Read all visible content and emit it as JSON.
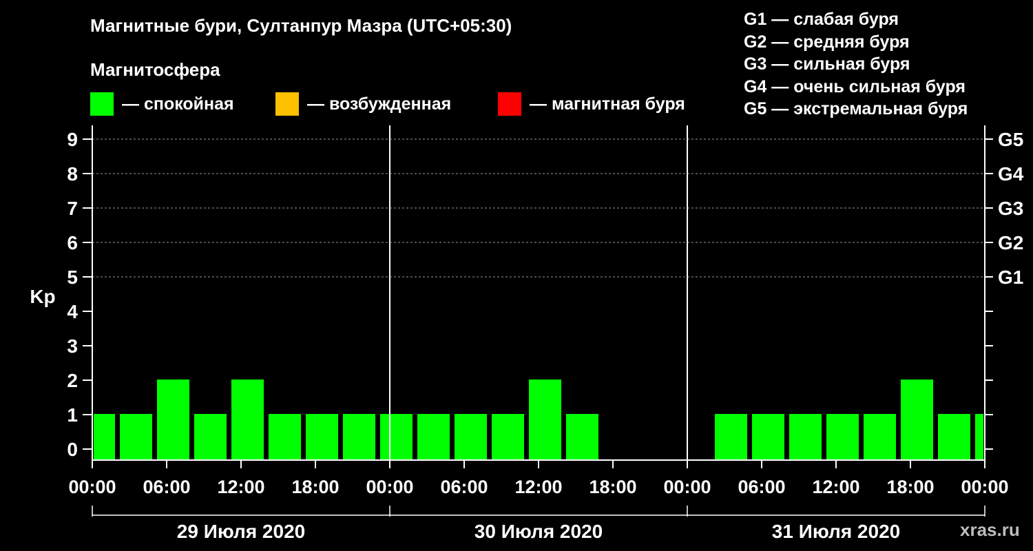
{
  "title": "Магнитные бури, Султанпур Мазра (UTC+05:30)",
  "magnetosphere_label": "Магнитосфера",
  "legend": [
    {
      "label": "— спокойная",
      "color": "#00ff00"
    },
    {
      "label": "— возбужденная",
      "color": "#ffc000"
    },
    {
      "label": "— магнитная буря",
      "color": "#ff0000"
    }
  ],
  "g_scale": [
    {
      "label": "G1 — слабая буря"
    },
    {
      "label": "G2 — средняя буря"
    },
    {
      "label": "G3 — сильная буря"
    },
    {
      "label": "G4 — очень сильная буря"
    },
    {
      "label": "G5 — экстремальная буря"
    }
  ],
  "watermark": "xras.ru",
  "chart_data": {
    "type": "bar",
    "ylabel": "Kp",
    "ylim": [
      0,
      9
    ],
    "y_ticks": [
      "0",
      "1",
      "2",
      "3",
      "4",
      "5",
      "6",
      "7",
      "8",
      "9"
    ],
    "right_ticks": [
      {
        "value": 5,
        "label": "G1"
      },
      {
        "value": 6,
        "label": "G2"
      },
      {
        "value": 7,
        "label": "G3"
      },
      {
        "value": 8,
        "label": "G4"
      },
      {
        "value": 9,
        "label": "G5"
      }
    ],
    "x_range_hours": [
      0,
      72
    ],
    "x_tick_labels": [
      "00:00",
      "06:00",
      "12:00",
      "18:00",
      "00:00",
      "06:00",
      "12:00",
      "18:00",
      "00:00",
      "06:00",
      "12:00",
      "18:00",
      "00:00"
    ],
    "days": [
      "29 Июля 2020",
      "30 Июля 2020",
      "31 Июля 2020"
    ],
    "bar_color": "#00ff00",
    "grid": "dashed horizontal at 5–9",
    "bars": [
      {
        "start": 0.0,
        "end": 2.0,
        "kp": 1
      },
      {
        "start": 2.0,
        "end": 5.0,
        "kp": 1
      },
      {
        "start": 5.0,
        "end": 8.0,
        "kp": 2
      },
      {
        "start": 8.0,
        "end": 11.0,
        "kp": 1
      },
      {
        "start": 11.0,
        "end": 14.0,
        "kp": 2
      },
      {
        "start": 14.0,
        "end": 17.0,
        "kp": 1
      },
      {
        "start": 17.0,
        "end": 20.0,
        "kp": 1
      },
      {
        "start": 20.0,
        "end": 23.0,
        "kp": 1
      },
      {
        "start": 23.0,
        "end": 26.0,
        "kp": 1
      },
      {
        "start": 26.0,
        "end": 29.0,
        "kp": 1
      },
      {
        "start": 29.0,
        "end": 32.0,
        "kp": 1
      },
      {
        "start": 32.0,
        "end": 35.0,
        "kp": 1
      },
      {
        "start": 35.0,
        "end": 38.0,
        "kp": 2
      },
      {
        "start": 38.0,
        "end": 41.0,
        "kp": 1
      },
      {
        "start": 50.0,
        "end": 53.0,
        "kp": 1
      },
      {
        "start": 53.0,
        "end": 56.0,
        "kp": 1
      },
      {
        "start": 56.0,
        "end": 59.0,
        "kp": 1
      },
      {
        "start": 59.0,
        "end": 62.0,
        "kp": 1
      },
      {
        "start": 62.0,
        "end": 65.0,
        "kp": 1
      },
      {
        "start": 65.0,
        "end": 68.0,
        "kp": 2
      },
      {
        "start": 68.0,
        "end": 71.0,
        "kp": 1
      },
      {
        "start": 71.0,
        "end": 72.0,
        "kp": 1
      }
    ]
  }
}
